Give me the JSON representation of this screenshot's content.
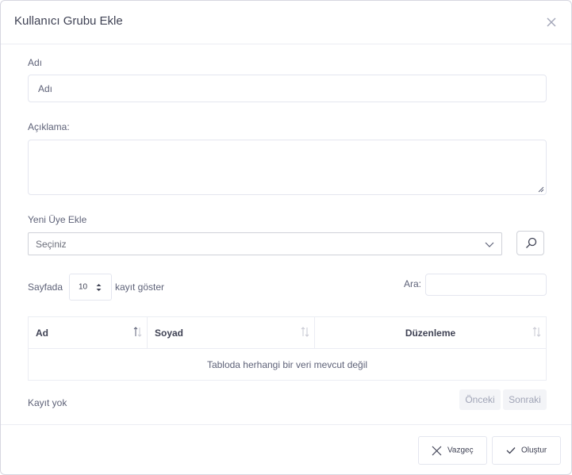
{
  "modal": {
    "title": "Kullanıcı Grubu Ekle"
  },
  "form": {
    "name_label": "Adı",
    "name_placeholder": "Adı",
    "description_label": "Açıklama:",
    "new_member_label": "Yeni Üye Ekle",
    "member_select_value": "Seçiniz"
  },
  "table": {
    "length_prefix": "Sayfada",
    "length_value": "10",
    "length_suffix": "kayıt göster",
    "search_label": "Ara:",
    "columns": [
      "Ad",
      "Soyad",
      "Düzenleme"
    ],
    "empty_message": "Tabloda herhangi bir veri mevcut değil",
    "info": "Kayıt yok",
    "prev_label": "Önceki",
    "next_label": "Sonraki"
  },
  "footer": {
    "cancel_label": "Vazgeç",
    "create_label": "Oluştur"
  },
  "icons": {
    "close": "close-icon",
    "search": "search-icon",
    "chevron": "chevron-down-icon",
    "sort": "sort-icon",
    "cancel": "x-icon",
    "create": "check-icon"
  }
}
